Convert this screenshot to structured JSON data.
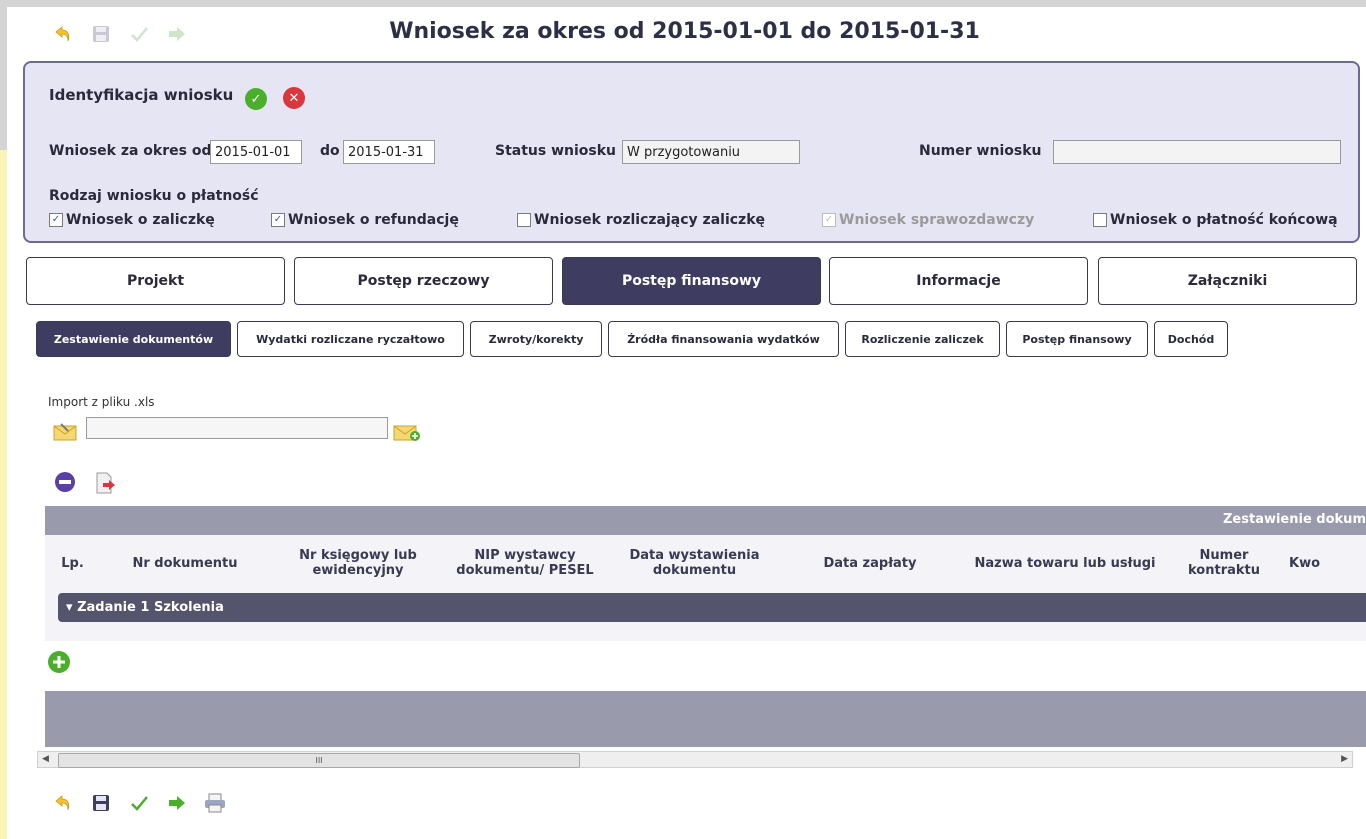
{
  "title": "Wniosek za okres od 2015-01-01 do 2015-01-31",
  "toolbar": {
    "icons": [
      "undo-icon",
      "save-icon",
      "check-icon",
      "forward-icon"
    ]
  },
  "ident": {
    "title": "Identyfikacja wniosku",
    "period_label": "Wniosek za okres od",
    "period_from": "2015-01-01",
    "to_label": "do",
    "period_to": "2015-01-31",
    "status_label": "Status wniosku",
    "status_value": "W przygotowaniu",
    "number_label": "Numer wniosku",
    "number_value": "",
    "type_label": "Rodzaj wniosku o płatność",
    "types": [
      {
        "label": "Wniosek o zaliczkę",
        "checked": true,
        "enabled": true
      },
      {
        "label": "Wniosek o refundację",
        "checked": true,
        "enabled": true
      },
      {
        "label": "Wniosek rozliczający zaliczkę",
        "checked": false,
        "enabled": true
      },
      {
        "label": "Wniosek sprawozdawczy",
        "checked": true,
        "enabled": false
      },
      {
        "label": "Wniosek o płatność końcową",
        "checked": false,
        "enabled": true
      }
    ]
  },
  "tabs": [
    "Projekt",
    "Postęp rzeczowy",
    "Postęp finansowy",
    "Informacje",
    "Załączniki"
  ],
  "subtabs": [
    "Zestawienie dokumentów",
    "Wydatki rozliczane ryczałtowo",
    "Zwroty/korekty",
    "Źródła finansowania wydatków",
    "Rozliczenie zaliczek",
    "Postęp finansowy",
    "Dochód"
  ],
  "import": {
    "label": "Import z pliku .xls",
    "value": ""
  },
  "table": {
    "caption": "Zestawienie dokum",
    "columns": [
      "Lp.",
      "Nr dokumentu",
      "Nr księgowy lub ewidencyjny",
      "NIP wystawcy dokumentu/ PESEL",
      "Data wystawienia dokumentu",
      "Data zapłaty",
      "Nazwa towaru lub usługi",
      "Numer kontraktu",
      "Kwo"
    ],
    "group": "Zadanie 1 Szkolenia"
  },
  "scroll_mark": "III",
  "colors": {
    "accent": "#3e3d61",
    "panel": "#e6e5f3",
    "band": "#9a9aad"
  }
}
